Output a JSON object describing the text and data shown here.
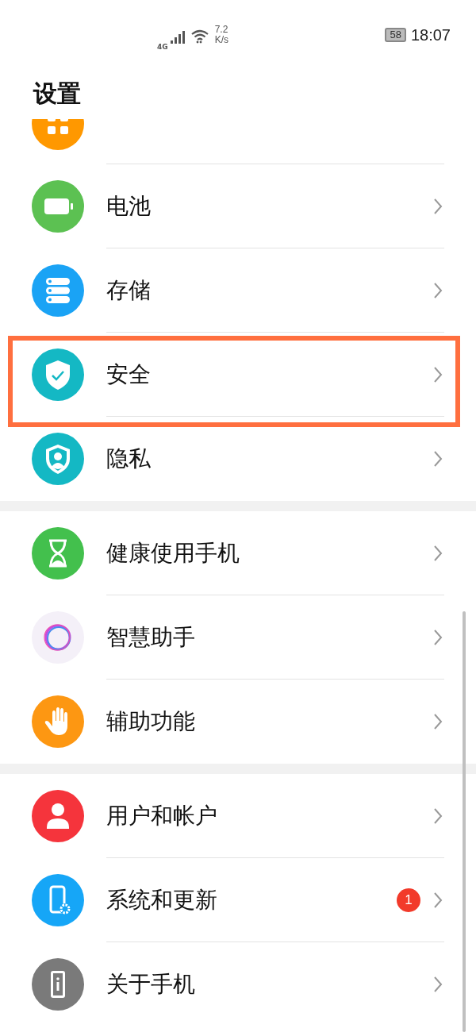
{
  "status_bar": {
    "network": "4G",
    "speed_value": "7.2",
    "speed_unit": "K/s",
    "battery": "58",
    "time": "18:07"
  },
  "title": "设置",
  "groups": [
    {
      "items": [
        {
          "kind": "apps",
          "partial": true,
          "highlighted": false
        },
        {
          "kind": "battery",
          "label": "电池",
          "partial": false,
          "highlighted": false
        },
        {
          "kind": "storage",
          "label": "存储",
          "partial": false,
          "highlighted": false
        },
        {
          "kind": "security",
          "label": "安全",
          "partial": false,
          "highlighted": true
        },
        {
          "kind": "privacy",
          "label": "隐私",
          "partial": false,
          "highlighted": false
        }
      ]
    },
    {
      "items": [
        {
          "kind": "health",
          "label": "健康使用手机",
          "partial": false,
          "highlighted": false
        },
        {
          "kind": "assistant",
          "label": "智慧助手",
          "partial": false,
          "highlighted": false
        },
        {
          "kind": "accessibility",
          "label": "辅助功能",
          "partial": false,
          "highlighted": false
        }
      ]
    },
    {
      "items": [
        {
          "kind": "user",
          "label": "用户和帐户",
          "partial": false,
          "highlighted": false
        },
        {
          "kind": "system",
          "label": "系统和更新",
          "badge": "1",
          "partial": false,
          "highlighted": false
        },
        {
          "kind": "about",
          "label": "关于手机",
          "partial": false,
          "highlighted": false
        }
      ]
    }
  ]
}
